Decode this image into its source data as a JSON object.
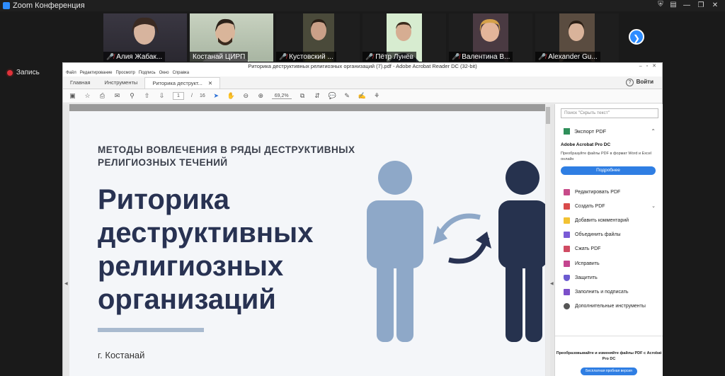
{
  "zoom": {
    "title": "Zoom Конференция",
    "recording_label": "Запись",
    "participants": [
      {
        "name": "Алия Жабак...",
        "muted": true,
        "bg": "#2f2f38",
        "active": false
      },
      {
        "name": "Костанай ЦИРП",
        "muted": false,
        "bg": "#b9c6b2",
        "active": true
      },
      {
        "name": "Кустовский ...",
        "muted": true,
        "bg": "#3a3f36",
        "active": false
      },
      {
        "name": "Пётр Лунёв",
        "muted": true,
        "bg": "#cfe8c7",
        "active": false
      },
      {
        "name": "Валентина В...",
        "muted": true,
        "bg": "#3c3a45",
        "active": false
      },
      {
        "name": "Alexander Gu...",
        "muted": true,
        "bg": "#2e2b29",
        "active": false
      }
    ],
    "next_page_icon": "chevron-right-icon"
  },
  "acrobat": {
    "window_title": "Риторика деструктивных религиозных организаций (7).pdf - Adobe Acrobat Reader DC (32-bit)",
    "menu": [
      "Файл",
      "Редактирование",
      "Просмотр",
      "Подпись",
      "Окно",
      "Справка"
    ],
    "tabs": {
      "home": "Главная",
      "tools": "Инструменты",
      "doc": "Риторика деструкт..."
    },
    "help": "?",
    "signin": "Войти",
    "toolbar": {
      "page_current": "1",
      "page_sep": "/",
      "page_total": "16",
      "zoom": "69,2%"
    }
  },
  "slide": {
    "subtitle_line1": "МЕТОДЫ ВОВЛЕЧЕНИЯ В РЯДЫ ДЕСТРУКТИВНЫХ",
    "subtitle_line2": "РЕЛИГИОЗНЫХ ТЕЧЕНИЙ",
    "title_lines": [
      "Риторика",
      "деструктивных",
      "религиозных",
      "организаций"
    ],
    "city": "г. Костанай",
    "colors": {
      "title": "#283252",
      "figure_light": "#8ea8c8",
      "figure_dark": "#26324e",
      "arrow": "#283252"
    }
  },
  "right_pane": {
    "search_placeholder": "Поиск \"Скрыть текст\"",
    "export_pdf": "Экспорт PDF",
    "pro_title": "Adobe Acrobat Pro DC",
    "pro_desc": "Преобразуйте файлы PDF в формат Word и Excel онлайн",
    "pro_button": "Подробнее",
    "tools": [
      {
        "label": "Редактировать PDF",
        "color": "#c74b89",
        "has_chevron": false
      },
      {
        "label": "Создать PDF",
        "color": "#d94a4a",
        "has_chevron": true
      },
      {
        "label": "Добавить комментарий",
        "color": "#f2c233",
        "has_chevron": false
      },
      {
        "label": "Объединить файлы",
        "color": "#7a5bd6",
        "has_chevron": false
      },
      {
        "label": "Сжать PDF",
        "color": "#d04b63",
        "has_chevron": false
      },
      {
        "label": "Исправить",
        "color": "#c4458f",
        "has_chevron": false
      },
      {
        "label": "Защитить",
        "color": "#6c5bd0",
        "has_chevron": false
      },
      {
        "label": "Заполнить и подписать",
        "color": "#7b4fc9",
        "has_chevron": false
      },
      {
        "label": "Дополнительные инструменты",
        "color": "#555555",
        "has_chevron": false
      }
    ],
    "footer_text": "Преобразовывайте и изменяйте файлы PDF с Acrobat Pro DC",
    "footer_button": "Бесплатная пробная версия"
  }
}
